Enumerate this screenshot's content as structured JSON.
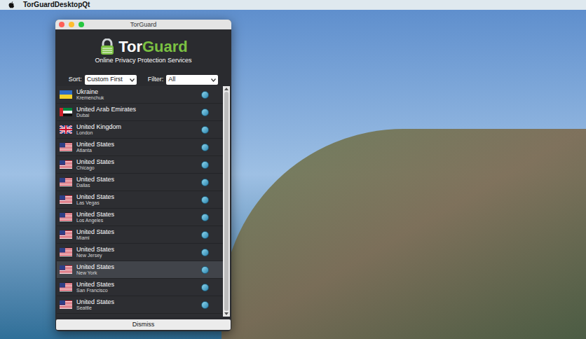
{
  "menu_bar": {
    "app_name": "TorGuardDesktopQt"
  },
  "window": {
    "title": "TorGuard"
  },
  "logo": {
    "brand_first": "Tor",
    "brand_second": "Guard",
    "tagline": "Online Privacy Protection Services"
  },
  "controls": {
    "sort": {
      "label": "Sort:",
      "value": "Custom First"
    },
    "filter": {
      "label": "Filter:",
      "value": "All"
    }
  },
  "servers": [
    {
      "country": "Ukraine",
      "city": "Kremenchuk",
      "kind": "ua",
      "selected": false
    },
    {
      "country": "United Arab Emirates",
      "city": "Dubai",
      "kind": "ae",
      "selected": false
    },
    {
      "country": "United Kingdom",
      "city": "London",
      "kind": "gb",
      "selected": false
    },
    {
      "country": "United States",
      "city": "Atlanta",
      "kind": "us",
      "selected": false
    },
    {
      "country": "United States",
      "city": "Chicago",
      "kind": "us",
      "selected": false
    },
    {
      "country": "United States",
      "city": "Dallas",
      "kind": "us",
      "selected": false
    },
    {
      "country": "United States",
      "city": "Las Vegas",
      "kind": "us",
      "selected": false
    },
    {
      "country": "United States",
      "city": "Los Angeles",
      "kind": "us",
      "selected": false
    },
    {
      "country": "United States",
      "city": "Miami",
      "kind": "us",
      "selected": false
    },
    {
      "country": "United States",
      "city": "New Jersey",
      "kind": "us",
      "selected": false
    },
    {
      "country": "United States",
      "city": "New York",
      "kind": "us",
      "selected": true
    },
    {
      "country": "United States",
      "city": "San Francisco",
      "kind": "us",
      "selected": false
    },
    {
      "country": "United States",
      "city": "Seattle",
      "kind": "us",
      "selected": false
    }
  ],
  "buttons": [
    "Dismiss"
  ]
}
